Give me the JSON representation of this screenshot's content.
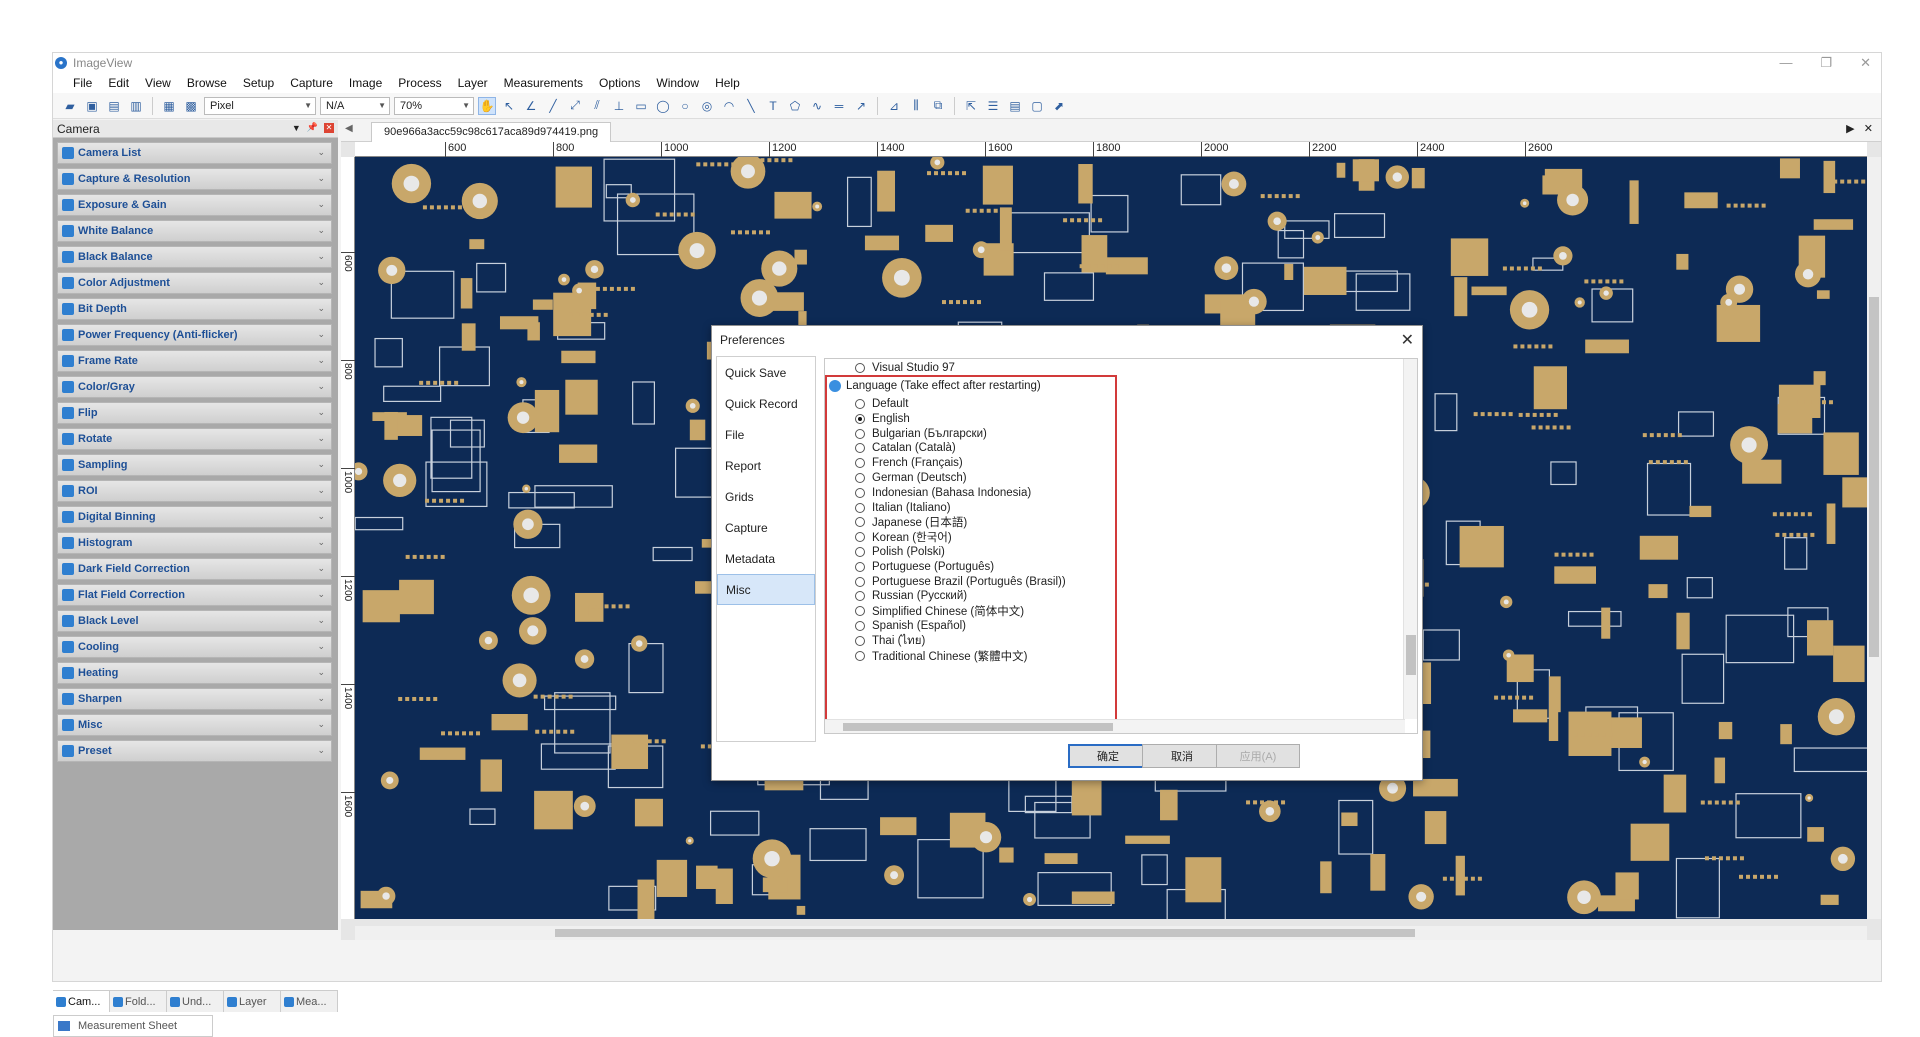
{
  "app": {
    "title": "ImageView"
  },
  "menu": [
    "File",
    "Edit",
    "View",
    "Browse",
    "Setup",
    "Capture",
    "Image",
    "Process",
    "Layer",
    "Measurements",
    "Options",
    "Window",
    "Help"
  ],
  "toolbar": {
    "unit_combo": "Pixel",
    "value_combo": "N/A",
    "zoom_combo": "70%"
  },
  "left_panel": {
    "title": "Camera",
    "items": [
      "Camera List",
      "Capture & Resolution",
      "Exposure & Gain",
      "White Balance",
      "Black Balance",
      "Color Adjustment",
      "Bit Depth",
      "Power Frequency (Anti-flicker)",
      "Frame Rate",
      "Color/Gray",
      "Flip",
      "Rotate",
      "Sampling",
      "ROI",
      "Digital Binning",
      "Histogram",
      "Dark Field Correction",
      "Flat Field Correction",
      "Black Level",
      "Cooling",
      "Heating",
      "Sharpen",
      "Misc",
      "Preset"
    ],
    "tabs": [
      "Cam...",
      "Fold...",
      "Und...",
      "Layer",
      "Mea..."
    ],
    "bottom_sheet": "Measurement Sheet"
  },
  "document": {
    "tab_name": "90e966a3acc59c98c617aca89d974419.png",
    "ruler_h": [
      "600",
      "800",
      "1000",
      "1200",
      "1400",
      "1600",
      "1800",
      "2000",
      "2200",
      "2400",
      "2600"
    ],
    "ruler_v": [
      "600",
      "800",
      "1000",
      "1200",
      "1400",
      "1600"
    ]
  },
  "dialog": {
    "title": "Preferences",
    "nav": [
      "Quick Save",
      "Quick Record",
      "File",
      "Report",
      "Grids",
      "Capture",
      "Metadata",
      "Misc"
    ],
    "nav_active": "Misc",
    "top_option": "Visual Studio 97",
    "language_header": "Language (Take effect after restarting)",
    "languages": [
      "Default",
      "English",
      "Bulgarian (Български)",
      "Catalan (Català)",
      "French (Français)",
      "German (Deutsch)",
      "Indonesian (Bahasa Indonesia)",
      "Italian (Italiano)",
      "Japanese (日本語)",
      "Korean (한국어)",
      "Polish (Polski)",
      "Portuguese (Português)",
      "Portuguese Brazil (Português (Brasil))",
      "Russian (Русский)",
      "Simplified Chinese (简体中文)",
      "Spanish (Español)",
      "Thai (ไทย)",
      "Traditional Chinese (繁體中文)"
    ],
    "selected_language": "English",
    "buttons": {
      "ok": "确定",
      "cancel": "取消",
      "apply": "应用(A)"
    }
  },
  "colors": {
    "accent": "#2a6cc4",
    "highlight_box": "#d23a3a",
    "pcb_board": "#0d2a55",
    "pcb_copper": "#c8a76a"
  }
}
